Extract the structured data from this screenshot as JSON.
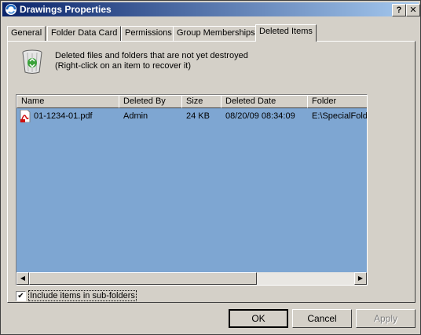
{
  "window": {
    "title": "Drawings Properties",
    "help_label": "?",
    "close_label": "✕"
  },
  "tabs": [
    {
      "label": "General"
    },
    {
      "label": "Folder Data Card"
    },
    {
      "label": "Permissions"
    },
    {
      "label": "Group Memberships"
    },
    {
      "label": "Deleted Items",
      "active": true
    }
  ],
  "info": {
    "line1": "Deleted files and folders that are not yet destroyed",
    "line2": "(Right-click on an item to recover it)"
  },
  "list": {
    "columns": [
      "Name",
      "Deleted By",
      "Size",
      "Deleted Date",
      "Folder"
    ],
    "rows": [
      {
        "name": "01-1234-01.pdf",
        "deleted_by": "Admin",
        "size": "24 KB",
        "deleted_date": "08/20/09 08:34:09",
        "folder": "E:\\SpecialFolder"
      }
    ]
  },
  "options": {
    "include_subfolders_label": "Include items in sub-folders",
    "include_subfolders_checked": true
  },
  "buttons": {
    "ok": "OK",
    "cancel": "Cancel",
    "apply": "Apply"
  },
  "colors": {
    "list_background": "#7ea6d2",
    "title_start": "#0a246a",
    "title_end": "#a6caf0"
  },
  "icons": {
    "app": "vault-app-icon",
    "recycle": "recycle-bin-icon",
    "pdf": "pdf-file-icon"
  }
}
